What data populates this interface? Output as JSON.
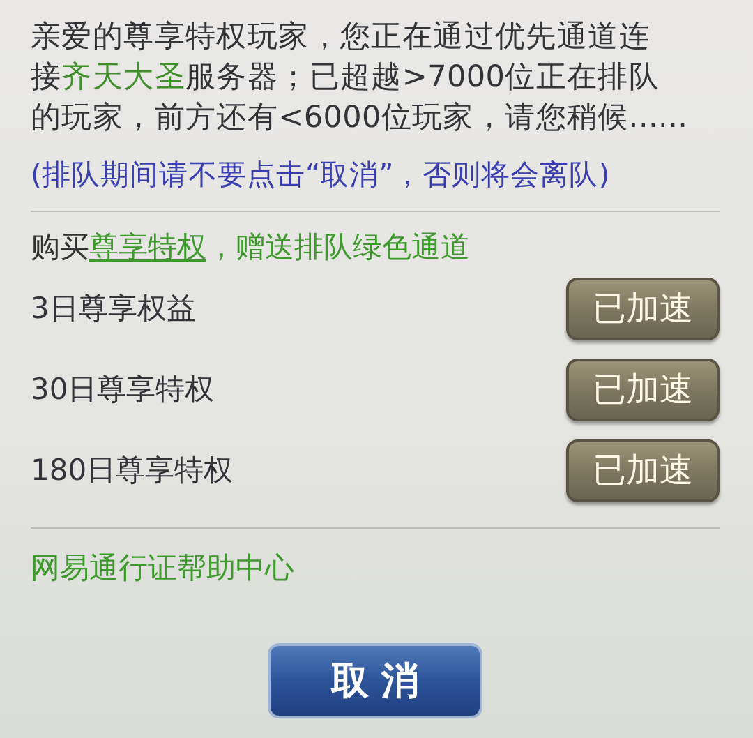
{
  "message_lines": [
    [
      {
        "kind": "plain",
        "text": "亲爱的尊享特权玩家，您正在通过优先通道连"
      }
    ],
    [
      {
        "kind": "plain",
        "text": "接"
      },
      {
        "kind": "highlight",
        "text": "齐天大圣"
      },
      {
        "kind": "plain",
        "text": "服务器；已超越>7000位正在排队"
      }
    ],
    [
      {
        "kind": "plain",
        "text": "的玩家，前方还有<6000位玩家，请您稍候......"
      }
    ]
  ],
  "warning": "(排队期间请不要点击“取消”，否则将会离队)",
  "promo": {
    "prefix": "购买",
    "link": "尊享特权",
    "suffix": "，赠送排队绿色通道"
  },
  "privileges": [
    {
      "name": "3日尊享权益",
      "button": "已加速"
    },
    {
      "name": "30日尊享特权",
      "button": "已加速"
    },
    {
      "name": "180日尊享特权",
      "button": "已加速"
    }
  ],
  "help_link": "网易通行证帮助中心",
  "cancel_button": "取 消"
}
